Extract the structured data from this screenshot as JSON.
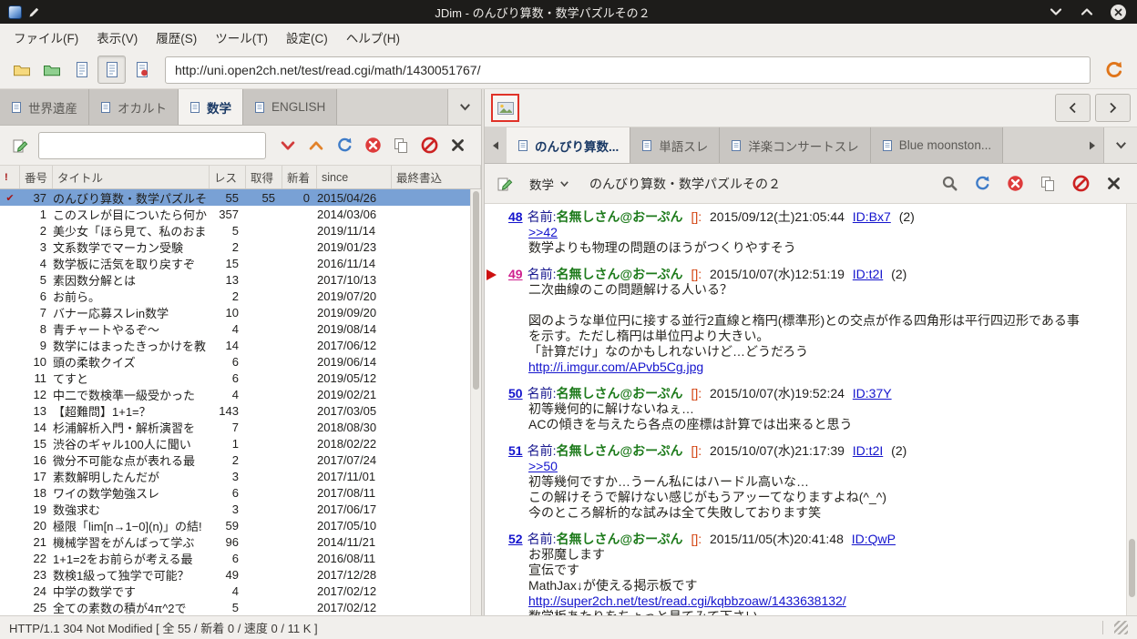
{
  "window": {
    "title": "JDim - のんびり算数・数学パズルその２"
  },
  "menu": {
    "items": [
      "ファイル(F)",
      "表示(V)",
      "履歴(S)",
      "ツール(T)",
      "設定(C)",
      "ヘルプ(H)"
    ]
  },
  "toolbar": {
    "url": "http://uni.open2ch.net/test/read.cgi/math/1430051767/"
  },
  "left_pane": {
    "tabs": [
      {
        "label": "世界遺産"
      },
      {
        "label": "オカルト"
      },
      {
        "label": "数学",
        "active": true
      },
      {
        "label": "ENGLISH"
      }
    ],
    "search_value": "",
    "table": {
      "headers": {
        "mark": "!",
        "num": "番号",
        "title": "タイトル",
        "res": "レス",
        "got": "取得",
        "new": "新着",
        "since": "since",
        "last": "最終書込"
      },
      "rows": [
        {
          "mark": "✔",
          "num": "37",
          "title": "のんびり算数・数学パズルそ",
          "res": "55",
          "got": "55",
          "new": "0",
          "since": "2015/04/26",
          "last": "",
          "selected": true
        },
        {
          "mark": "",
          "num": "1",
          "title": "このスレが目についたら何か",
          "res": "357",
          "got": "",
          "new": "",
          "since": "2014/03/06",
          "last": ""
        },
        {
          "mark": "",
          "num": "2",
          "title": "美少女「ほら見て、私のおま",
          "res": "5",
          "got": "",
          "new": "",
          "since": "2019/11/14",
          "last": ""
        },
        {
          "mark": "",
          "num": "3",
          "title": "文系数学でマーカン受験",
          "res": "2",
          "got": "",
          "new": "",
          "since": "2019/01/23",
          "last": ""
        },
        {
          "mark": "",
          "num": "4",
          "title": "数学板に活気を取り戻すぞ",
          "res": "15",
          "got": "",
          "new": "",
          "since": "2016/11/14",
          "last": ""
        },
        {
          "mark": "",
          "num": "5",
          "title": "素因数分解とは",
          "res": "13",
          "got": "",
          "new": "",
          "since": "2017/10/13",
          "last": ""
        },
        {
          "mark": "",
          "num": "6",
          "title": "お前ら。",
          "res": "2",
          "got": "",
          "new": "",
          "since": "2019/07/20",
          "last": ""
        },
        {
          "mark": "",
          "num": "7",
          "title": "バナー応募スレin数学",
          "res": "10",
          "got": "",
          "new": "",
          "since": "2019/09/20",
          "last": ""
        },
        {
          "mark": "",
          "num": "8",
          "title": "青チャートやるぞ〜",
          "res": "4",
          "got": "",
          "new": "",
          "since": "2019/08/14",
          "last": ""
        },
        {
          "mark": "",
          "num": "9",
          "title": "数学にはまったきっかけを教",
          "res": "14",
          "got": "",
          "new": "",
          "since": "2017/06/12",
          "last": ""
        },
        {
          "mark": "",
          "num": "10",
          "title": "頭の柔軟クイズ",
          "res": "6",
          "got": "",
          "new": "",
          "since": "2019/06/14",
          "last": ""
        },
        {
          "mark": "",
          "num": "11",
          "title": "てすと",
          "res": "6",
          "got": "",
          "new": "",
          "since": "2019/05/12",
          "last": ""
        },
        {
          "mark": "",
          "num": "12",
          "title": "中二で数検準一級受かった",
          "res": "4",
          "got": "",
          "new": "",
          "since": "2019/02/21",
          "last": ""
        },
        {
          "mark": "",
          "num": "13",
          "title": "【超難問】1+1=？",
          "res": "143",
          "got": "",
          "new": "",
          "since": "2017/03/05",
          "last": ""
        },
        {
          "mark": "",
          "num": "14",
          "title": "杉浦解析入門・解析演習を",
          "res": "7",
          "got": "",
          "new": "",
          "since": "2018/08/30",
          "last": ""
        },
        {
          "mark": "",
          "num": "15",
          "title": "渋谷のギャル100人に聞い",
          "res": "1",
          "got": "",
          "new": "",
          "since": "2018/02/22",
          "last": ""
        },
        {
          "mark": "",
          "num": "16",
          "title": "微分不可能な点が表れる最",
          "res": "2",
          "got": "",
          "new": "",
          "since": "2017/07/24",
          "last": ""
        },
        {
          "mark": "",
          "num": "17",
          "title": "素数解明したんだが",
          "res": "3",
          "got": "",
          "new": "",
          "since": "2017/11/01",
          "last": ""
        },
        {
          "mark": "",
          "num": "18",
          "title": "ワイの数学勉強スレ",
          "res": "6",
          "got": "",
          "new": "",
          "since": "2017/08/11",
          "last": ""
        },
        {
          "mark": "",
          "num": "19",
          "title": "数強求む",
          "res": "3",
          "got": "",
          "new": "",
          "since": "2017/06/17",
          "last": ""
        },
        {
          "mark": "",
          "num": "20",
          "title": "極限「lim[n→1−0](n)」の結!",
          "res": "59",
          "got": "",
          "new": "",
          "since": "2017/05/10",
          "last": ""
        },
        {
          "mark": "",
          "num": "21",
          "title": "機械学習をがんばって学ぶ",
          "res": "96",
          "got": "",
          "new": "",
          "since": "2014/11/21",
          "last": ""
        },
        {
          "mark": "",
          "num": "22",
          "title": "1+1=2をお前らが考える最",
          "res": "6",
          "got": "",
          "new": "",
          "since": "2016/08/11",
          "last": ""
        },
        {
          "mark": "",
          "num": "23",
          "title": "数検1級って独学で可能？",
          "res": "49",
          "got": "",
          "new": "",
          "since": "2017/12/28",
          "last": ""
        },
        {
          "mark": "",
          "num": "24",
          "title": "中学の数学です",
          "res": "4",
          "got": "",
          "new": "",
          "since": "2017/02/12",
          "last": ""
        },
        {
          "mark": "",
          "num": "25",
          "title": "全ての素数の積が4π^2で",
          "res": "5",
          "got": "",
          "new": "",
          "since": "2017/02/12",
          "last": ""
        }
      ]
    }
  },
  "right_pane": {
    "tabs": [
      {
        "label": "のんびり算数...",
        "active": true
      },
      {
        "label": "単語スレ"
      },
      {
        "label": "洋楽コンサートスレ"
      },
      {
        "label": "Blue moonston..."
      }
    ],
    "toolbar": {
      "board": "数学",
      "thread_title": "のんびり算数・数学パズルその２"
    },
    "posts": [
      {
        "num": "48",
        "name_label": "名前:",
        "name": "名無しさん@おーぷん",
        "mail": "[]:",
        "date": "2015/09/12(土)21:05:44",
        "id": "ID:Bx7",
        "count": "(2)",
        "lines": [
          {
            "text": ">>42",
            "link": true
          },
          {
            "text": "数学よりも物理の問題のほうがつくりやすそう"
          }
        ]
      },
      {
        "num": "49",
        "visited": true,
        "bookmarked": true,
        "name_label": "名前:",
        "name": "名無しさん@おーぷん",
        "mail": "[]:",
        "date": "2015/10/07(水)12:51:19",
        "id": "ID:t2I",
        "count": "(2)",
        "lines": [
          {
            "text": "二次曲線のこの問題解ける人いる？"
          },
          {
            "text": ""
          },
          {
            "text": "図のような単位円に接する並行2直線と楕円(標準形)との交点が作る四角形は平行四辺形である事"
          },
          {
            "text": "を示す。ただし楕円は単位円より大きい。"
          },
          {
            "text": "「計算だけ」なのかもしれないけど…どうだろう"
          },
          {
            "text": "http://i.imgur.com/APvb5Cg.jpg",
            "link": true
          }
        ]
      },
      {
        "num": "50",
        "name_label": "名前:",
        "name": "名無しさん@おーぷん",
        "mail": "[]:",
        "date": "2015/10/07(水)19:52:24",
        "id": "ID:37Y",
        "count": "",
        "lines": [
          {
            "text": "初等幾何的に解けないねぇ…"
          },
          {
            "text": "ACの傾きを与えたら各点の座標は計算では出来ると思う"
          }
        ]
      },
      {
        "num": "51",
        "name_label": "名前:",
        "name": "名無しさん@おーぷん",
        "mail": "[]:",
        "date": "2015/10/07(水)21:17:39",
        "id": "ID:t2I",
        "count": "(2)",
        "lines": [
          {
            "text": ">>50",
            "link": true
          },
          {
            "text": "初等幾何ですか…うーん私にはハードル高いな…"
          },
          {
            "text": "この解けそうで解けない感じがもうアッーてなりますよね(^_^)"
          },
          {
            "text": "今のところ解析的な試みは全て失敗しております笑"
          }
        ]
      },
      {
        "num": "52",
        "name_label": "名前:",
        "name": "名無しさん@おーぷん",
        "mail": "[]:",
        "date": "2015/11/05(木)20:41:48",
        "id": "ID:QwP",
        "count": "",
        "lines": [
          {
            "text": "お邪魔します"
          },
          {
            "text": "宣伝です"
          },
          {
            "text": "MathJax↓が使える掲示板です"
          },
          {
            "text": "http://super2ch.net/test/read.cgi/kqbbzoaw/1433638132/",
            "link": true
          },
          {
            "text": "数学板あたりをちょっと見てみて下さい"
          }
        ]
      }
    ]
  },
  "status_bar": {
    "text": "HTTP/1.1 304 Not Modified [ 全 55 / 新着 0 / 速度 0 / 11 K ]"
  }
}
